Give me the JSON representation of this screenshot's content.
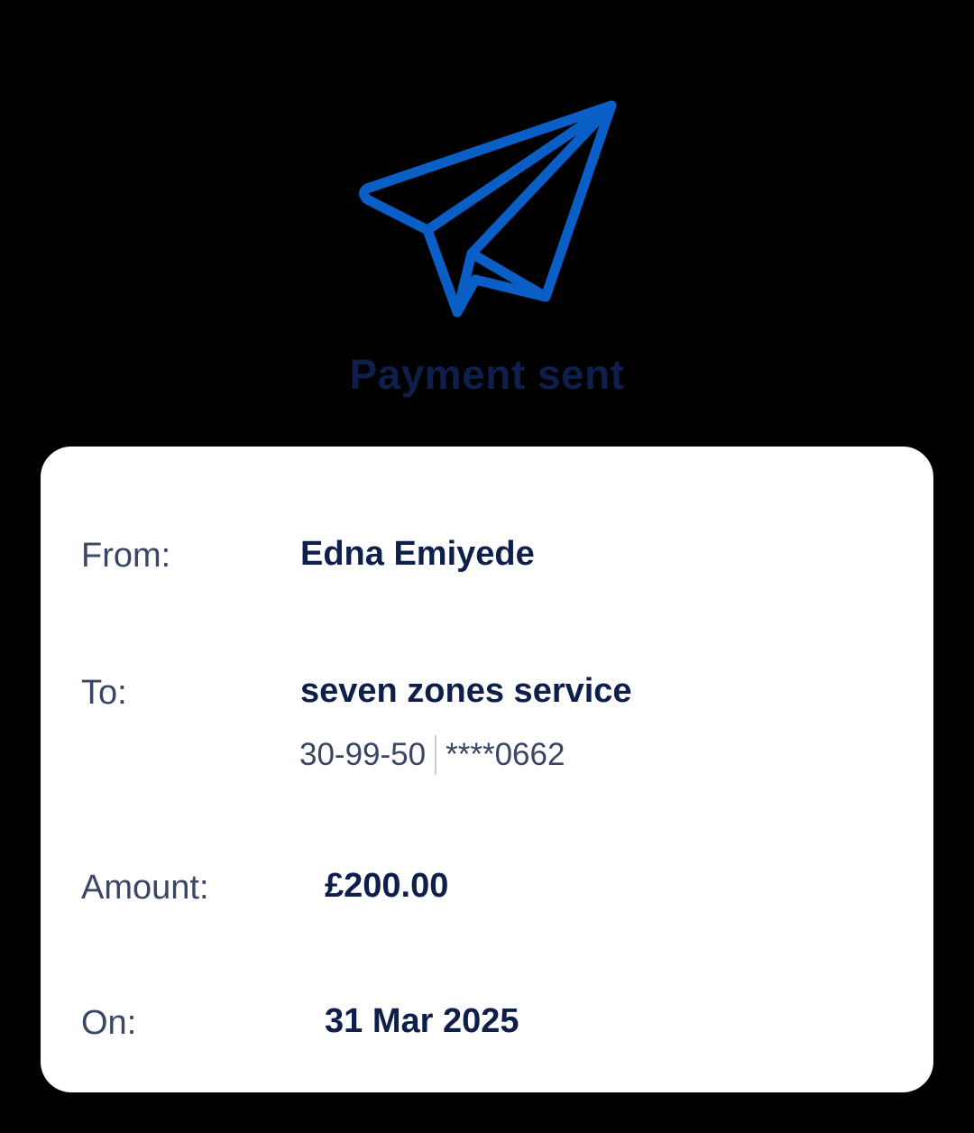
{
  "header": {
    "icon": "paper-plane-icon",
    "title": "Payment sent",
    "accent_color": "#0a5fc6",
    "title_color": "#0d1f4a"
  },
  "details": {
    "from_label": "From:",
    "from_value": "Edna Emiyede",
    "to_label": "To:",
    "to_value": "seven zones service",
    "sort_code": "30-99-50",
    "account_masked": "****0662",
    "amount_label": "Amount:",
    "amount_value": "£200.00",
    "on_label": "On:",
    "on_value": "31 Mar 2025"
  }
}
